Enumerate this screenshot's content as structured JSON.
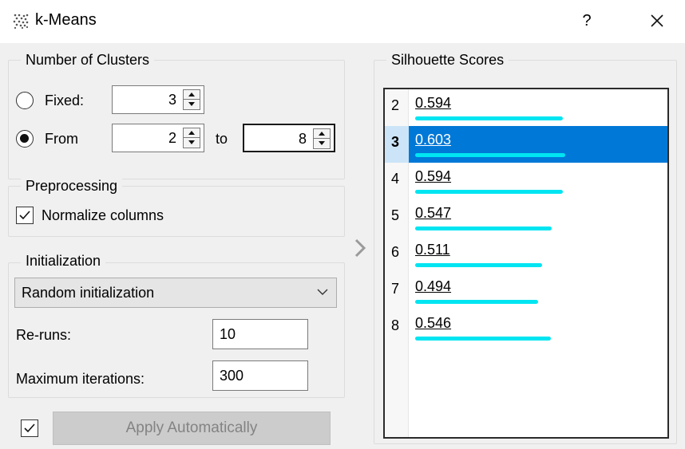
{
  "window": {
    "title": "k-Means",
    "help_label": "?"
  },
  "clusters": {
    "group_title": "Number of Clusters",
    "fixed_label": "Fixed:",
    "fixed_value": "3",
    "from_label": "From",
    "from_value": "2",
    "to_label": "to",
    "to_value": "8",
    "selected_mode": "From"
  },
  "preprocessing": {
    "group_title": "Preprocessing",
    "normalize_label": "Normalize columns",
    "normalize_checked": true
  },
  "initialization": {
    "group_title": "Initialization",
    "method": "Random initialization",
    "reruns_label": "Re-runs:",
    "reruns_value": "10",
    "max_iter_label": "Maximum iterations:",
    "max_iter_value": "300"
  },
  "apply": {
    "auto_checked": true,
    "button_label": "Apply Automatically"
  },
  "silhouette": {
    "group_title": "Silhouette Scores",
    "bar_color": "#00e5f2",
    "selected_color": "#0078d7",
    "selected_k": "3",
    "rows": [
      {
        "k": "2",
        "score": "0.594"
      },
      {
        "k": "3",
        "score": "0.603"
      },
      {
        "k": "4",
        "score": "0.594"
      },
      {
        "k": "5",
        "score": "0.547"
      },
      {
        "k": "6",
        "score": "0.511"
      },
      {
        "k": "7",
        "score": "0.494"
      },
      {
        "k": "8",
        "score": "0.546"
      }
    ]
  }
}
